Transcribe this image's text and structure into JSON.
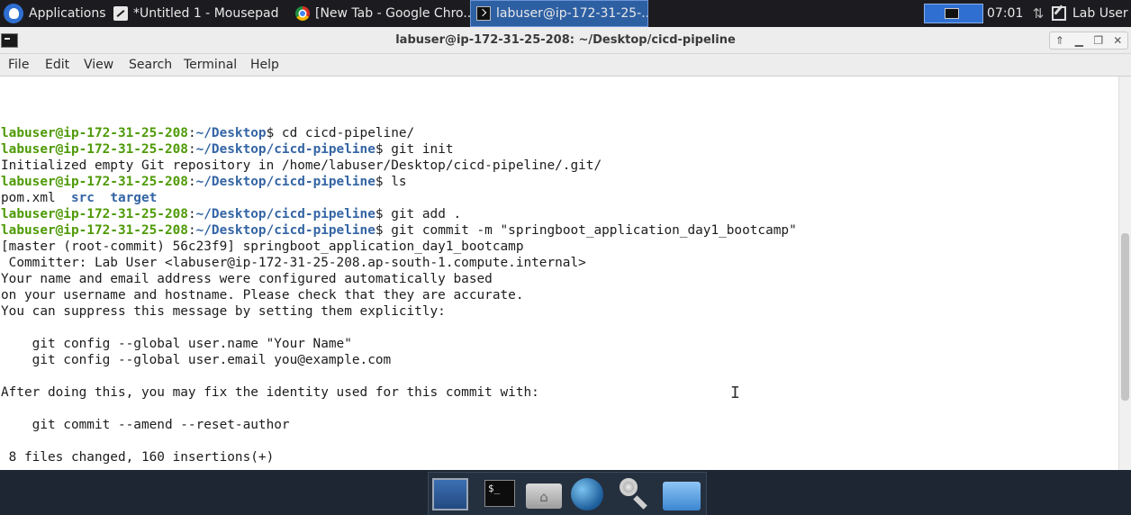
{
  "panel": {
    "applications_label": "Applications",
    "tasks": [
      {
        "label": "*Untitled 1 - Mousepad"
      },
      {
        "label": "[New Tab - Google Chro..."
      },
      {
        "label": "labuser@ip-172-31-25-..."
      }
    ],
    "clock": "07:01",
    "user": "Lab User"
  },
  "window": {
    "title": "labuser@ip-172-31-25-208: ~/Desktop/cicd-pipeline",
    "menu": [
      "File",
      "Edit",
      "View",
      "Search",
      "Terminal",
      "Help"
    ]
  },
  "terminal": {
    "user_host": "labuser@ip-172-31-25-208",
    "sep": ":",
    "lines": [
      {
        "kind": "prompt",
        "path": "~/Desktop",
        "cmd": " cd cicd-pipeline/"
      },
      {
        "kind": "prompt",
        "path": "~/Desktop/cicd-pipeline",
        "cmd": " git init"
      },
      {
        "kind": "out",
        "text": "Initialized empty Git repository in /home/labuser/Desktop/cicd-pipeline/.git/"
      },
      {
        "kind": "prompt",
        "path": "~/Desktop/cicd-pipeline",
        "cmd": " ls"
      },
      {
        "kind": "ls",
        "file": "pom.xml",
        "dirs": [
          "src",
          "target"
        ]
      },
      {
        "kind": "prompt",
        "path": "~/Desktop/cicd-pipeline",
        "cmd": " git add ."
      },
      {
        "kind": "prompt",
        "path": "~/Desktop/cicd-pipeline",
        "cmd": " git commit -m \"springboot_application_day1_bootcamp\""
      },
      {
        "kind": "out",
        "text": "[master (root-commit) 56c23f9] springboot_application_day1_bootcamp"
      },
      {
        "kind": "out",
        "text": " Committer: Lab User <labuser@ip-172-31-25-208.ap-south-1.compute.internal>"
      },
      {
        "kind": "out",
        "text": "Your name and email address were configured automatically based"
      },
      {
        "kind": "out",
        "text": "on your username and hostname. Please check that they are accurate."
      },
      {
        "kind": "out",
        "text": "You can suppress this message by setting them explicitly:"
      },
      {
        "kind": "out",
        "text": ""
      },
      {
        "kind": "out",
        "text": "    git config --global user.name \"Your Name\""
      },
      {
        "kind": "out",
        "text": "    git config --global user.email you@example.com"
      },
      {
        "kind": "out",
        "text": ""
      },
      {
        "kind": "out",
        "text": "After doing this, you may fix the identity used for this commit with:"
      },
      {
        "kind": "out",
        "text": ""
      },
      {
        "kind": "out",
        "text": "    git commit --amend --reset-author"
      },
      {
        "kind": "out",
        "text": ""
      },
      {
        "kind": "out",
        "text": " 8 files changed, 160 insertions(+)"
      }
    ]
  },
  "dock": {
    "terminal_glyph": "$_",
    "items": [
      "desktop-icon",
      "terminal-icon",
      "home-folder-icon",
      "web-browser-icon",
      "app-finder-icon",
      "file-manager-icon"
    ]
  },
  "colors": {
    "prompt_user": "#4e9a06",
    "prompt_path": "#3465a4",
    "panel_bg": "#1c1c20",
    "active_task": "#2d5fa3"
  }
}
